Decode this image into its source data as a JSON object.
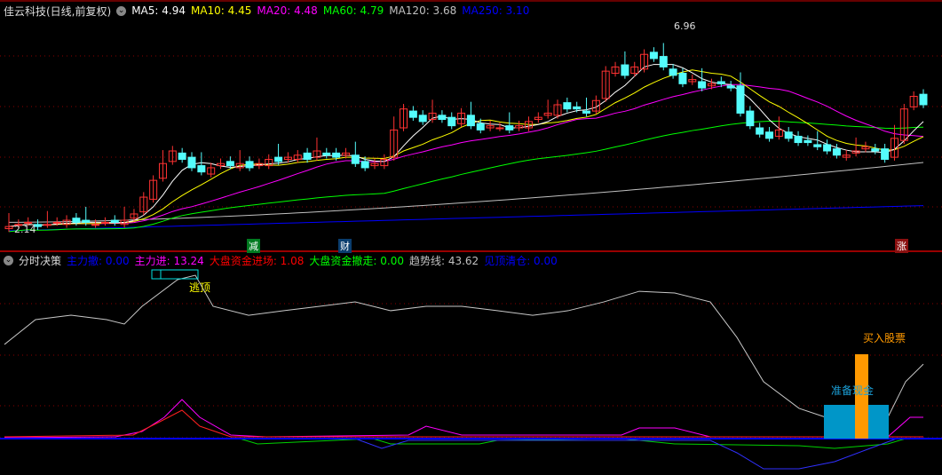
{
  "main": {
    "title": "佳云科技(日线,前复权)",
    "ma": [
      {
        "label": "MA5: 4.94",
        "color": "#ffffff"
      },
      {
        "label": "MA10: 4.45",
        "color": "#ffff00"
      },
      {
        "label": "MA20: 4.48",
        "color": "#ff00ff"
      },
      {
        "label": "MA60: 4.79",
        "color": "#00ff00"
      },
      {
        "label": "MA120: 3.68",
        "color": "#c0c0c0"
      },
      {
        "label": "MA250: 3.10",
        "color": "#0000ff"
      }
    ],
    "high_label": "6.96",
    "low_label": "2.14",
    "markers": [
      {
        "text": "减",
        "bg": "#007a20"
      },
      {
        "text": "财",
        "bg": "#0a3d6e"
      },
      {
        "text": "涨",
        "bg": "#8a1010"
      }
    ],
    "closes": [
      2.2,
      2.25,
      2.3,
      2.2,
      2.25,
      2.3,
      2.35,
      2.3,
      2.3,
      2.25,
      2.3,
      2.3,
      2.35,
      2.5,
      2.9,
      3.3,
      3.7,
      4.0,
      3.8,
      3.6,
      3.5,
      3.6,
      3.7,
      3.65,
      3.7,
      3.6,
      3.7,
      3.8,
      3.75,
      3.85,
      3.9,
      3.8,
      4.0,
      3.9,
      3.85,
      3.95,
      3.7,
      3.6,
      3.7,
      3.8,
      4.5,
      5.0,
      4.8,
      4.7,
      4.9,
      4.75,
      4.6,
      4.9,
      4.6,
      4.5,
      4.6,
      4.55,
      4.5,
      4.6,
      4.7,
      4.8,
      4.9,
      5.1,
      5.0,
      5.0,
      4.9,
      5.2,
      5.9,
      6.0,
      5.8,
      6.0,
      6.3,
      6.2,
      6.0,
      5.8,
      5.6,
      5.7,
      5.5,
      5.6,
      5.6,
      5.5,
      4.9,
      4.6,
      4.4,
      4.3,
      4.5,
      4.3,
      4.2,
      4.2,
      4.1,
      4.0,
      3.9,
      3.9,
      4.0,
      4.1,
      4.0,
      3.8,
      4.3,
      5.0,
      5.3,
      5.1
    ]
  },
  "sub": {
    "title": "分时决策",
    "items": [
      {
        "label": "主力撤: 0.00",
        "color": "#0000ff"
      },
      {
        "label": "主力进: 13.24",
        "color": "#ff00ff"
      },
      {
        "label": "大盘资金进场: 1.08",
        "color": "#ff0000"
      },
      {
        "label": "大盘资金撤走: 0.00",
        "color": "#00ff00"
      },
      {
        "label": "趋势线: 43.62",
        "color": "#c0c0c0"
      },
      {
        "label": "见顶清仓: 0.00",
        "color": "#0000ff"
      }
    ],
    "escape_top": "逃顶",
    "buy_label": "买入股票",
    "prepare_label": "准备现金",
    "trend": [
      55.3,
      70,
      72.6,
      70,
      67.4,
      77.9,
      93.7,
      96.3,
      77.9,
      72.6,
      75.3,
      77.9,
      80.5,
      75.3,
      77.9,
      77.9,
      75.3,
      72.6,
      75.3,
      80.5,
      86.8,
      85.8,
      80.5,
      59.5,
      33.2,
      17.4,
      12.1,
      12.1,
      33.2,
      43.62
    ],
    "trend_x": [
      5,
      40,
      80,
      120,
      140,
      160,
      200,
      220,
      240,
      280,
      320,
      360,
      400,
      440,
      480,
      520,
      560,
      600,
      640,
      680,
      720,
      760,
      800,
      830,
      860,
      900,
      930,
      1000,
      1020,
      1040
    ]
  }
}
